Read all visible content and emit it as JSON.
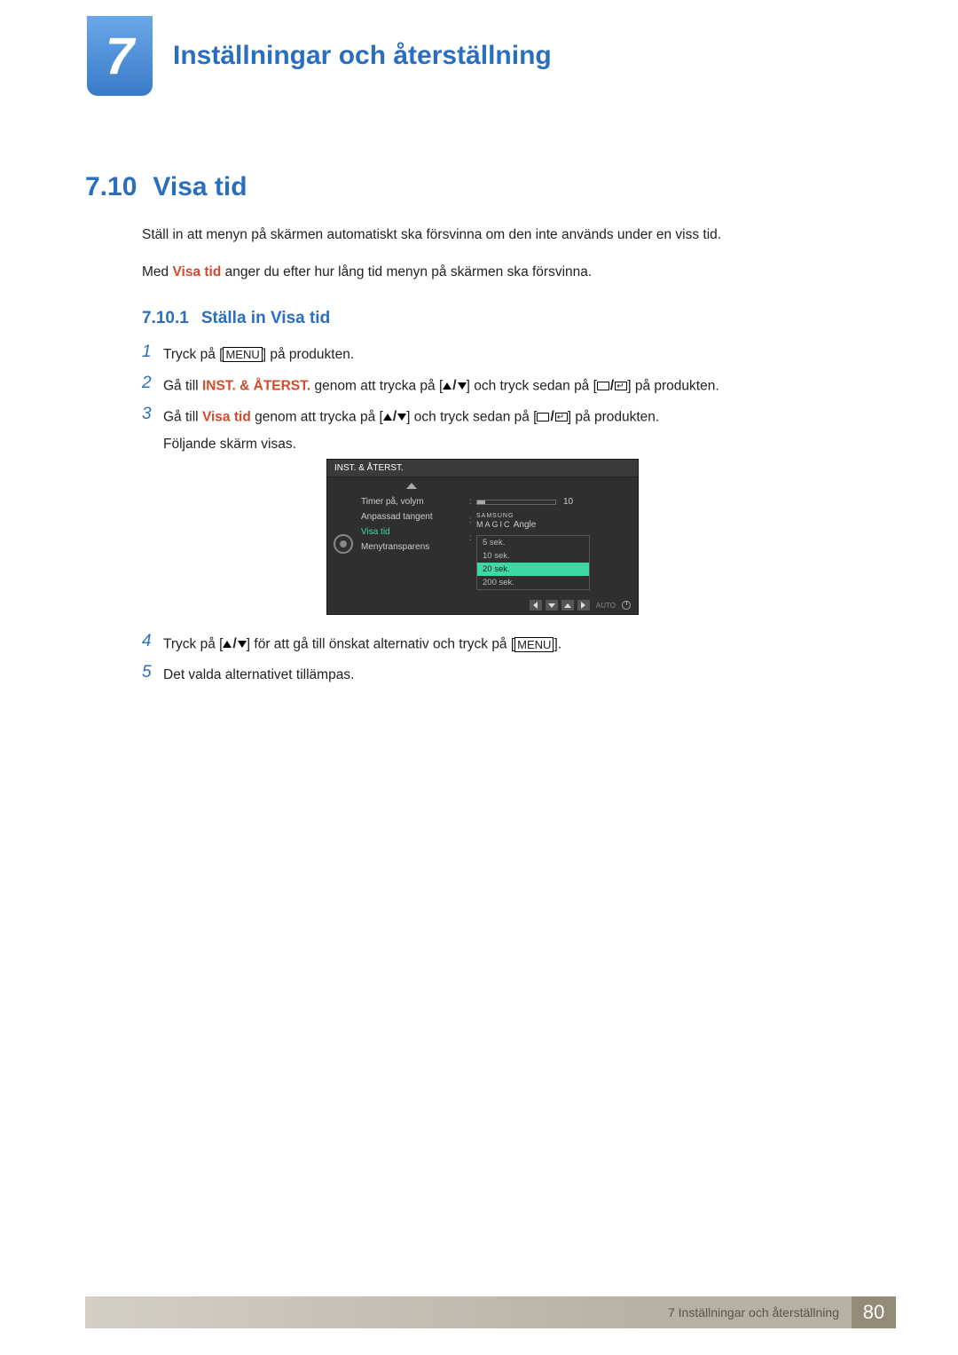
{
  "chapter": {
    "number": "7",
    "title": "Inställningar och återställning"
  },
  "section": {
    "number": "7.10",
    "title": "Visa tid"
  },
  "paragraphs": {
    "p1": "Ställ in att menyn på skärmen automatiskt ska försvinna om den inte används under en viss tid.",
    "p2_pre": "Med ",
    "p2_hl": "Visa tid",
    "p2_post": " anger du efter hur lång tid menyn på skärmen ska försvinna."
  },
  "subsection": {
    "number": "7.10.1",
    "title": "Ställa in Visa tid"
  },
  "steps": {
    "s1_num": "1",
    "s1_a": "Tryck på [",
    "s1_menu": "MENU",
    "s1_b": "] på produkten.",
    "s2_num": "2",
    "s2_a": "Gå till ",
    "s2_hl": "INST. & ÅTERST.",
    "s2_b": " genom att trycka på [",
    "s2_c": "] och tryck sedan på [",
    "s2_d": "] på produkten.",
    "s3_num": "3",
    "s3_a": "Gå till ",
    "s3_hl": "Visa tid",
    "s3_b": " genom att trycka på [",
    "s3_c": "] och tryck sedan på [",
    "s3_d": "] på produkten.",
    "s3_e": "Följande skärm visas.",
    "s4_num": "4",
    "s4_a": "Tryck på [",
    "s4_b": "] för att gå till önskat alternativ och tryck på [",
    "s4_menu": "MENU",
    "s4_c": "].",
    "s5_num": "5",
    "s5_a": "Det valda alternativet tillämpas."
  },
  "osd": {
    "header": "INST. & ÅTERST.",
    "items": {
      "timer": "Timer på, volym",
      "custom": "Anpassad tangent",
      "visa": "Visa tid",
      "trans": "Menytransparens"
    },
    "timer_val": "10",
    "custom_samsung": "SAMSUNG",
    "custom_magic": "MAGIC",
    "custom_angle": " Angle",
    "options": {
      "o1": "5 sek.",
      "o2": "10 sek.",
      "o3": "20 sek.",
      "o4": "200 sek."
    },
    "auto": "AUTO"
  },
  "footer": {
    "label": "7 Inställningar och återställning",
    "page": "80"
  }
}
